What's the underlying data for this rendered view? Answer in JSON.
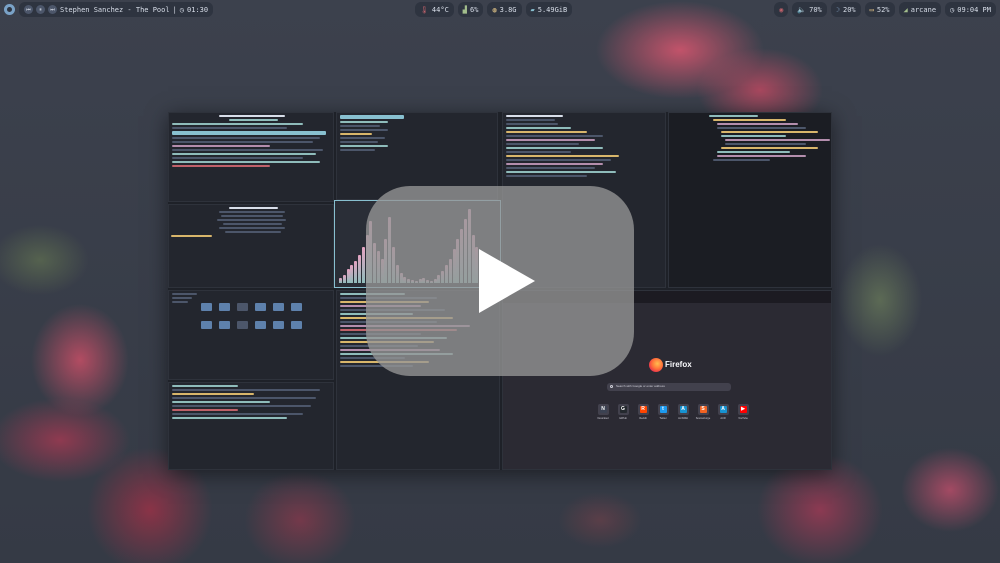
{
  "topbar": {
    "media": {
      "prev_icon": "skip-back-icon",
      "play_icon": "pause-icon",
      "next_icon": "skip-forward-icon",
      "now_playing": "Stephen Sanchez - The Pool",
      "separator": "|",
      "elapsed": "01:30"
    },
    "system": {
      "temperature": "44°C",
      "cpu": "6%",
      "memory": "3.8G",
      "disk": "5.49GiB"
    },
    "status": {
      "eye_icon": "eye-icon",
      "volume": "70%",
      "brightness": "20%",
      "battery": "52%",
      "wifi": "arcane",
      "clock": "09:04 PM"
    }
  },
  "firefox": {
    "title": "Firefox",
    "search_placeholder": "Search with Google or enter address",
    "shortcuts": [
      {
        "label": "Nextcloud",
        "color": "#3b4252",
        "glyph": "N"
      },
      {
        "label": "GitHub",
        "color": "#24292e",
        "glyph": "G"
      },
      {
        "label": "Reddit",
        "color": "#ff4500",
        "glyph": "R"
      },
      {
        "label": "Twitter",
        "color": "#1d9bf0",
        "glyph": "t"
      },
      {
        "label": "ArchWiki",
        "color": "#1793d1",
        "glyph": "A"
      },
      {
        "label": "SourceForge",
        "color": "#f26322",
        "glyph": "S"
      },
      {
        "label": "AUR",
        "color": "#1793d1",
        "glyph": "A"
      },
      {
        "label": "YouTube",
        "color": "#ff0000",
        "glyph": "▶"
      }
    ]
  },
  "overlay": {
    "play_icon": "youtube-play-icon"
  },
  "visualizer": {
    "color_low": "#8fbcbb",
    "color_high": "#e5a3c2",
    "levels": [
      0.06,
      0.1,
      0.18,
      0.22,
      0.28,
      0.35,
      0.45,
      0.6,
      0.78,
      0.5,
      0.4,
      0.3,
      0.55,
      0.82,
      0.45,
      0.22,
      0.12,
      0.08,
      0.05,
      0.04,
      0.03,
      0.05,
      0.06,
      0.04,
      0.03,
      0.05,
      0.1,
      0.15,
      0.22,
      0.3,
      0.42,
      0.55,
      0.68,
      0.8,
      0.92,
      0.6,
      0.45,
      0.32,
      0.25,
      0.15,
      0.1,
      0.06
    ]
  }
}
